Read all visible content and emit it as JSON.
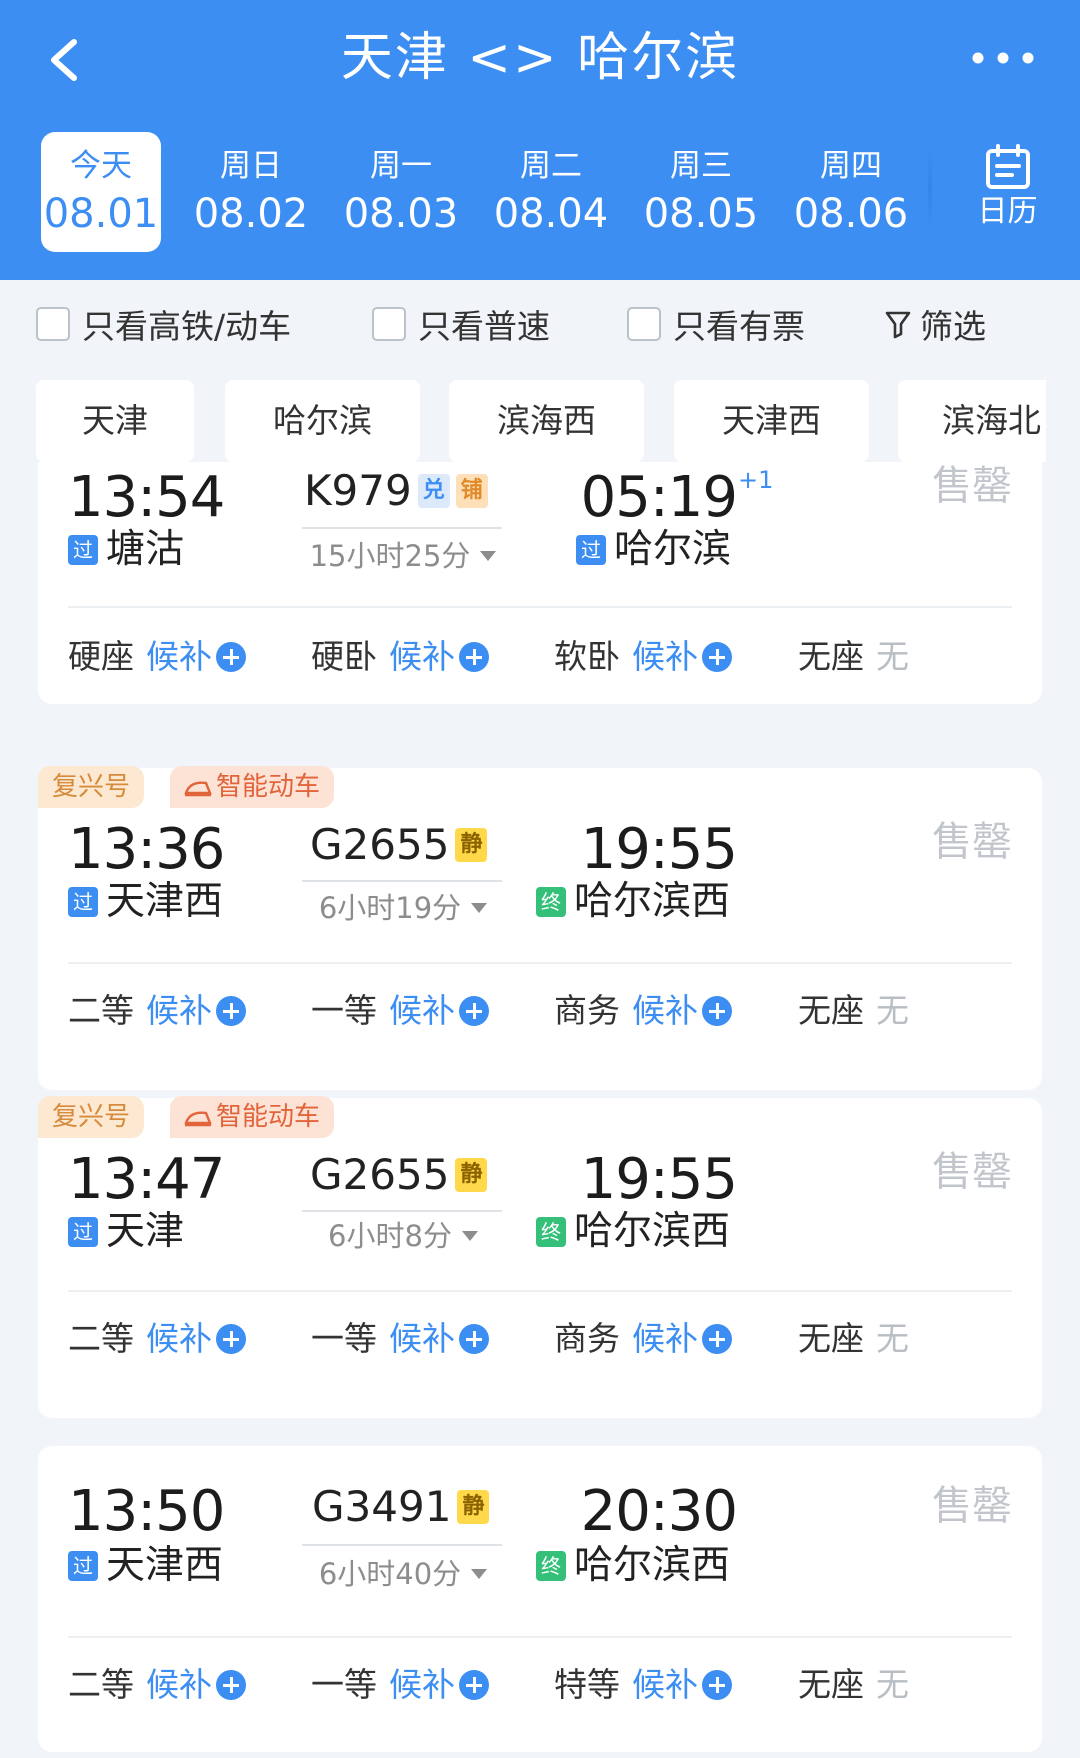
{
  "header": {
    "title": "天津 <> 哈尔滨",
    "back_icon": "chevron-left-icon",
    "more_icon": "more-dots-icon"
  },
  "dates": [
    {
      "weekday": "今天",
      "date": "08.01",
      "active": true
    },
    {
      "weekday": "周日",
      "date": "08.02"
    },
    {
      "weekday": "周一",
      "date": "08.03"
    },
    {
      "weekday": "周二",
      "date": "08.04"
    },
    {
      "weekday": "周三",
      "date": "08.05"
    },
    {
      "weekday": "周四",
      "date": "08.06"
    }
  ],
  "calendar": {
    "label": "日历",
    "icon": "calendar-icon"
  },
  "filters": {
    "high_speed": "只看高铁/动车",
    "normal": "只看普速",
    "available": "只看有票",
    "filter": "筛选"
  },
  "stations": [
    "天津",
    "哈尔滨",
    "滨海西",
    "天津西",
    "滨海北"
  ],
  "trains": [
    {
      "depart_time": "13:54",
      "depart_station": "塘沽",
      "depart_badge": "过",
      "train_no": "K979",
      "tags": [
        "兑",
        "铺"
      ],
      "duration": "15小时25分",
      "arrive_time": "05:19",
      "arrive_plus": "+1",
      "arrive_station": "哈尔滨",
      "arrive_badge": "过",
      "status": "售罄",
      "seats": [
        {
          "name": "硬座",
          "value": "候补"
        },
        {
          "name": "硬卧",
          "value": "候补"
        },
        {
          "name": "软卧",
          "value": "候补"
        },
        {
          "name": "无座",
          "value": "无"
        }
      ]
    },
    {
      "labels": [
        "复兴号",
        "智能动车"
      ],
      "depart_time": "13:36",
      "depart_station": "天津西",
      "depart_badge": "过",
      "train_no": "G2655",
      "tags": [
        "静"
      ],
      "duration": "6小时19分",
      "arrive_time": "19:55",
      "arrive_station": "哈尔滨西",
      "arrive_badge": "终",
      "status": "售罄",
      "seats": [
        {
          "name": "二等",
          "value": "候补"
        },
        {
          "name": "一等",
          "value": "候补"
        },
        {
          "name": "商务",
          "value": "候补"
        },
        {
          "name": "无座",
          "value": "无"
        }
      ]
    },
    {
      "labels": [
        "复兴号",
        "智能动车"
      ],
      "depart_time": "13:47",
      "depart_station": "天津",
      "depart_badge": "过",
      "train_no": "G2655",
      "tags": [
        "静"
      ],
      "duration": "6小时8分",
      "arrive_time": "19:55",
      "arrive_station": "哈尔滨西",
      "arrive_badge": "终",
      "status": "售罄",
      "seats": [
        {
          "name": "二等",
          "value": "候补"
        },
        {
          "name": "一等",
          "value": "候补"
        },
        {
          "name": "商务",
          "value": "候补"
        },
        {
          "name": "无座",
          "value": "无"
        }
      ]
    },
    {
      "depart_time": "13:50",
      "depart_station": "天津西",
      "depart_badge": "过",
      "train_no": "G3491",
      "tags": [
        "静"
      ],
      "duration": "6小时40分",
      "arrive_time": "20:30",
      "arrive_station": "哈尔滨西",
      "arrive_badge": "终",
      "status": "售罄",
      "seats": [
        {
          "name": "二等",
          "value": "候补"
        },
        {
          "name": "一等",
          "value": "候补"
        },
        {
          "name": "特等",
          "value": "候补"
        },
        {
          "name": "无座",
          "value": "无"
        }
      ]
    }
  ],
  "colors": {
    "primary": "#3d8ef2",
    "pass": "#3d8ef2",
    "terminal": "#35c07a",
    "sold_out": "#c2c6cc"
  }
}
